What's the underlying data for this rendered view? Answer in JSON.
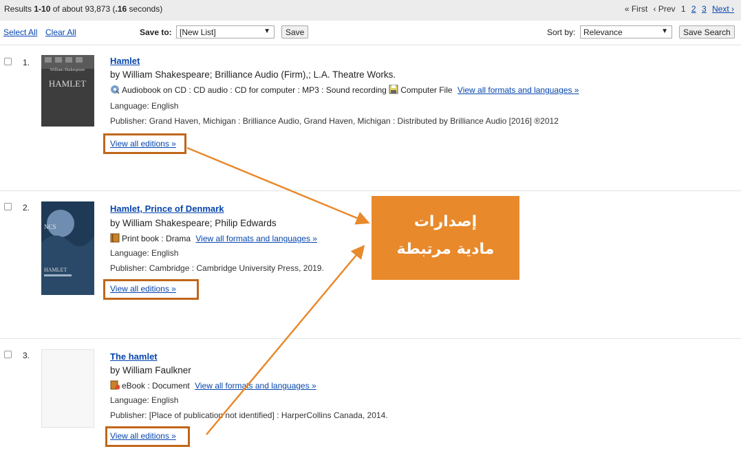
{
  "header": {
    "results_prefix": "Results",
    "results_range": "1-10",
    "results_middle": "of about",
    "results_total": "93,873",
    "results_time_open": "(",
    "results_time": ".16",
    "results_time_suffix": "seconds)",
    "pager": {
      "first": "« First",
      "prev": "‹ Prev",
      "page_current": "1",
      "page_2": "2",
      "page_3": "3",
      "next": "Next ›"
    }
  },
  "toolbar": {
    "select_all": "Select All",
    "clear_all": "Clear All",
    "save_to_label": "Save to:",
    "save_to_value": "[New List]",
    "save_button": "Save",
    "sort_by_label": "Sort by:",
    "sort_by_value": "Relevance",
    "save_search_button": "Save Search"
  },
  "results": [
    {
      "number": "1.",
      "title": "Hamlet",
      "byline": "by William Shakespeare; Brilliance Audio (Firm),; L.A. Theatre Works.",
      "formats_text_1": "Audiobook on CD : CD audio : CD for computer : MP3 : Sound recording",
      "formats_text_2": "Computer File",
      "view_formats": "View all formats and languages »",
      "language": "Language: English",
      "publisher": "Publisher: Grand Haven, Michigan : Brilliance Audio, Grand Haven, Michigan : Distributed by Brilliance Audio [2016] ®2012",
      "view_editions": "View all editions »",
      "cover_text_top": "William Shakespeare",
      "cover_text_title": "HAMLET"
    },
    {
      "number": "2.",
      "title": "Hamlet, Prince of Denmark",
      "byline": "by William Shakespeare; Philip Edwards",
      "formats_text_1": "Print book : Drama",
      "view_formats": "View all formats and languages »",
      "language": "Language: English",
      "publisher": "Publisher: Cambridge : Cambridge University Press, 2019.",
      "view_editions": "View all editions »",
      "cover_text_top": "NCS",
      "cover_text_title": "HAMLET"
    },
    {
      "number": "3.",
      "title": "The hamlet",
      "byline": "by William Faulkner",
      "formats_text_1": "eBook : Document",
      "view_formats": "View all formats and languages »",
      "language": "Language: English",
      "publisher": "Publisher: [Place of publication not identified] : HarperCollins Canada, 2014.",
      "view_editions": "View all editions »"
    }
  ],
  "callout": {
    "line_1": "إصدارات",
    "line_2": "مادية مرتبطة"
  },
  "colors": {
    "link": "#0645ad",
    "highlight": "#c0661a",
    "callout": "#e8892b"
  }
}
